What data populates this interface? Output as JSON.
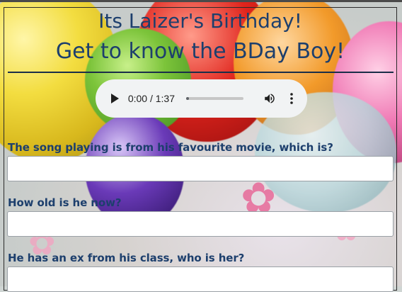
{
  "page": {
    "title_line1": "Its Laizer's Birthday!",
    "title_line2": "Get to know the BDay Boy!"
  },
  "audio_player": {
    "time_display": "0:00 / 1:37",
    "progress": 0.0,
    "icons": {
      "play": "play-icon",
      "volume": "volume-icon",
      "more": "more-options-icon"
    }
  },
  "questions": [
    {
      "label": "The song playing is from his favourite movie, which is?",
      "value": ""
    },
    {
      "label": "How old is he now?",
      "value": ""
    },
    {
      "label": "He has an ex from his class, who is her?",
      "value": ""
    }
  ],
  "colors": {
    "heading": "#1d3f6d",
    "rule": "#1a2e49",
    "player_bg": "#f1f3f4"
  }
}
